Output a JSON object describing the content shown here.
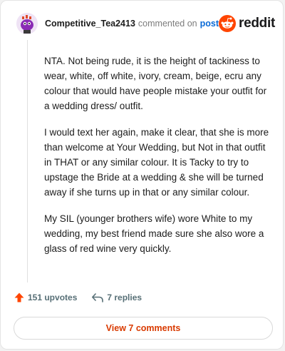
{
  "comment": {
    "username": "Competitive_Tea2413",
    "action": "commented on",
    "post_link": "post",
    "paragraphs": [
      "NTA. Not being rude, it is the height of tackiness to wear, white, off white, ivory, cream, beige, ecru any colour that would have people mistake your outfit for a wedding dress/ outfit.",
      "I would text her again, make it clear, that she is more than welcome at Your Wedding, but Not in that outfit in THAT or any similar colour. It is Tacky to try to upstage the Bride at a wedding & she will be turned away if she turns up in that or any similar colour.",
      "My SIL (younger brothers wife) wore White to my wedding, my best friend made sure she also wore a glass of red wine very quickly."
    ]
  },
  "brand": {
    "name": "reddit",
    "color": "#ff4500"
  },
  "footer": {
    "upvotes_label": "151 upvotes",
    "replies_label": "7 replies",
    "view_comments_label": "View 7 comments"
  },
  "icons": {
    "avatar": "avatar-icon",
    "upvote": "upvote-arrow-icon",
    "reply": "reply-arrow-icon",
    "reddit": "reddit-snoo-icon"
  },
  "colors": {
    "accent": "#ff4500",
    "link": "#0a6ad6",
    "button_text": "#d93a00"
  }
}
